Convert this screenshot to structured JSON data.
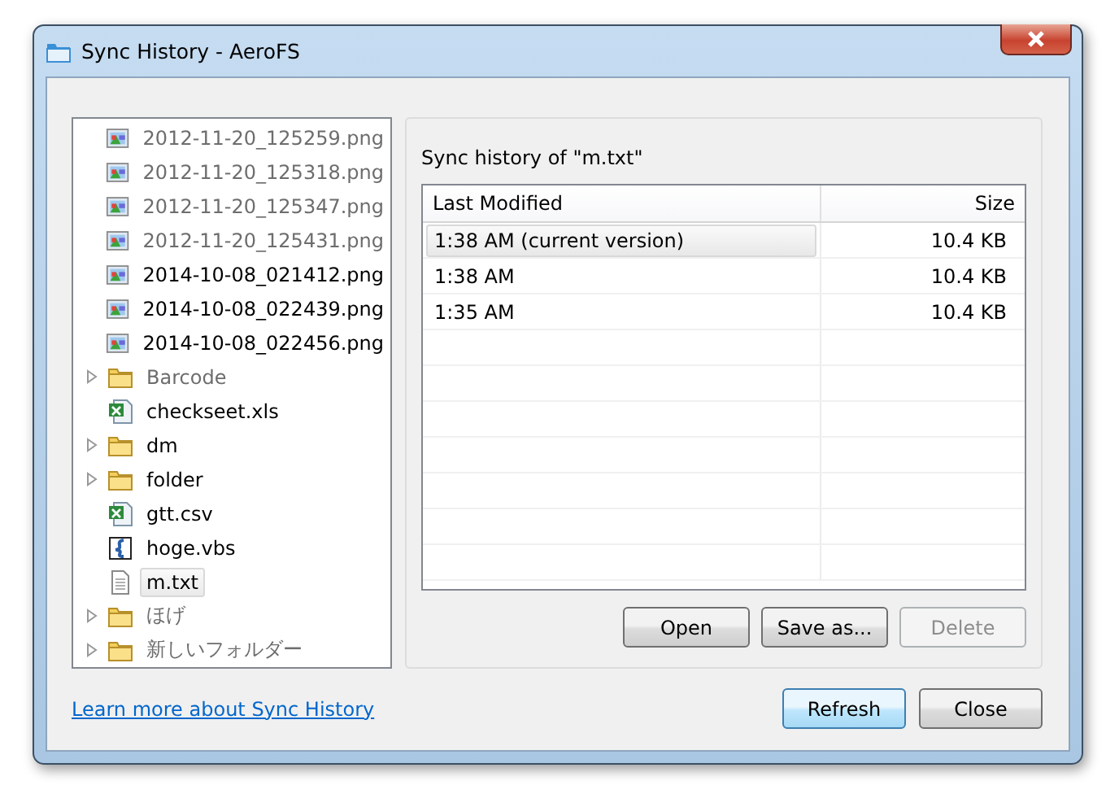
{
  "window": {
    "title": "Sync History - AeroFS"
  },
  "tree": [
    {
      "label": "2012-11-20_125259.png",
      "kind": "image",
      "dimmed": true,
      "selected": false
    },
    {
      "label": "2012-11-20_125318.png",
      "kind": "image",
      "dimmed": true,
      "selected": false
    },
    {
      "label": "2012-11-20_125347.png",
      "kind": "image",
      "dimmed": true,
      "selected": false
    },
    {
      "label": "2012-11-20_125431.png",
      "kind": "image",
      "dimmed": true,
      "selected": false
    },
    {
      "label": "2014-10-08_021412.png",
      "kind": "image",
      "dimmed": false,
      "selected": false
    },
    {
      "label": "2014-10-08_022439.png",
      "kind": "image",
      "dimmed": false,
      "selected": false
    },
    {
      "label": "2014-10-08_022456.png",
      "kind": "image",
      "dimmed": false,
      "selected": false
    },
    {
      "label": "Barcode",
      "kind": "folder",
      "dimmed": true,
      "selected": false
    },
    {
      "label": "checkseet.xls",
      "kind": "sheet",
      "dimmed": false,
      "selected": false
    },
    {
      "label": "dm",
      "kind": "folder",
      "dimmed": false,
      "selected": false
    },
    {
      "label": "folder",
      "kind": "folder",
      "dimmed": false,
      "selected": false
    },
    {
      "label": "gtt.csv",
      "kind": "sheet",
      "dimmed": false,
      "selected": false
    },
    {
      "label": "hoge.vbs",
      "kind": "script",
      "dimmed": false,
      "selected": false
    },
    {
      "label": "m.txt",
      "kind": "text",
      "dimmed": false,
      "selected": true
    },
    {
      "label": "ほげ",
      "kind": "folder",
      "dimmed": true,
      "selected": false
    },
    {
      "label": "新しいフォルダー",
      "kind": "folder",
      "dimmed": true,
      "selected": false
    }
  ],
  "history": {
    "heading": "Sync history of \"m.txt\"",
    "columns": [
      "Last Modified",
      "Size"
    ],
    "rows": [
      {
        "modified": "1:38 AM (current version)",
        "size": "10.4 KB",
        "selected": true
      },
      {
        "modified": "1:38 AM",
        "size": "10.4 KB",
        "selected": false
      },
      {
        "modified": "1:35 AM",
        "size": "10.4 KB",
        "selected": false
      }
    ],
    "buttons": [
      {
        "label": "Open",
        "disabled": false
      },
      {
        "label": "Save as...",
        "disabled": false
      },
      {
        "label": "Delete",
        "disabled": true
      }
    ]
  },
  "link": "Learn more about Sync History",
  "buttons": [
    {
      "label": "Refresh",
      "default": true
    },
    {
      "label": "Close",
      "default": false
    }
  ]
}
